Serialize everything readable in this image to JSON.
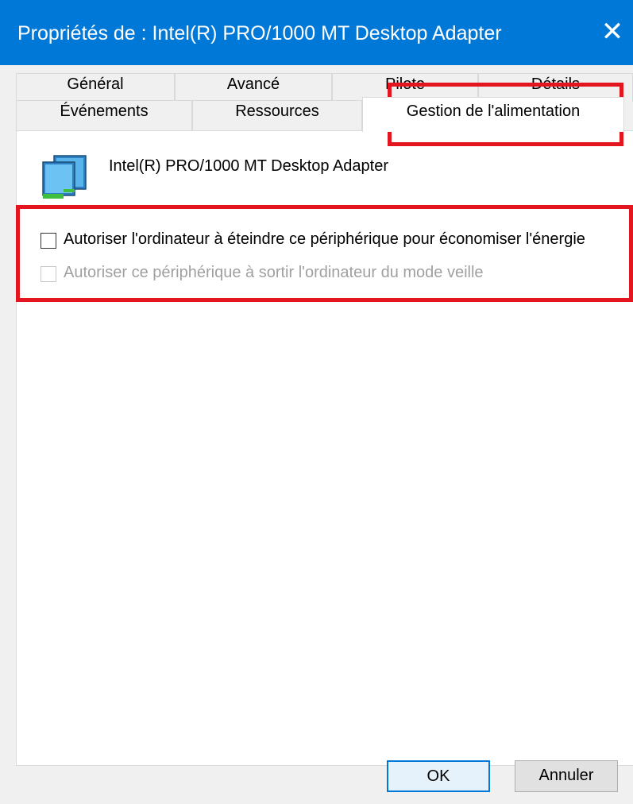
{
  "window": {
    "title": "Propriétés de : Intel(R) PRO/1000 MT Desktop Adapter",
    "close_glyph": "✕"
  },
  "tabs": {
    "row1": [
      "Général",
      "Avancé",
      "Pilote",
      "Détails"
    ],
    "row2": [
      "Événements",
      "Ressources",
      "Gestion de l'alimentation"
    ],
    "active": "Gestion de l'alimentation"
  },
  "device": {
    "name": "Intel(R) PRO/1000 MT Desktop Adapter",
    "icon": "network-adapter-icon"
  },
  "options": {
    "allow_turn_off": {
      "label": "Autoriser l'ordinateur à éteindre ce périphérique pour économiser l'énergie",
      "checked": false,
      "enabled": true
    },
    "allow_wake": {
      "label": "Autoriser ce périphérique à sortir l'ordinateur du mode veille",
      "checked": false,
      "enabled": false
    }
  },
  "buttons": {
    "ok": "OK",
    "cancel": "Annuler"
  },
  "colors": {
    "titlebar": "#0078d7",
    "highlight": "#e3151f"
  }
}
